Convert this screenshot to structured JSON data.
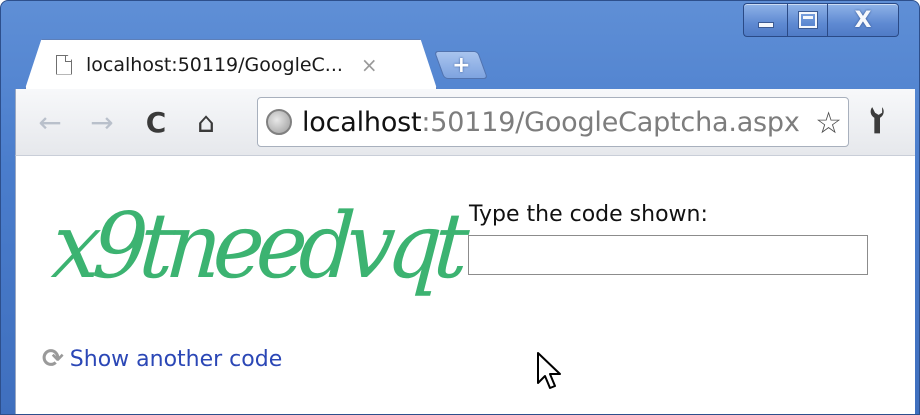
{
  "window": {
    "caption_min": "",
    "caption_max": "",
    "caption_close": "X"
  },
  "tab": {
    "title": "localhost:50119/GoogleC...",
    "close": "×",
    "new_tab": "+"
  },
  "toolbar": {
    "back": "←",
    "forward": "→",
    "reload": "C",
    "home": "⌂",
    "url_host": "localhost",
    "url_rest": ":50119/GoogleCaptcha.aspx",
    "star": "☆",
    "wrench": "🔧"
  },
  "content": {
    "captcha_text": "x9tneedvqt",
    "prompt_label": "Type the code shown:",
    "code_value": "",
    "refresh_icon": "⟳",
    "another_link": "Show another code"
  },
  "colors": {
    "captcha": "#3cb371",
    "link": "#2b47b6",
    "frame": "#4a7dcc"
  },
  "icons": {
    "page": "page-icon",
    "globe": "globe-icon",
    "star": "star-icon",
    "wrench": "wrench-icon",
    "refresh": "refresh-icon",
    "cursor": "mouse-pointer-icon"
  }
}
